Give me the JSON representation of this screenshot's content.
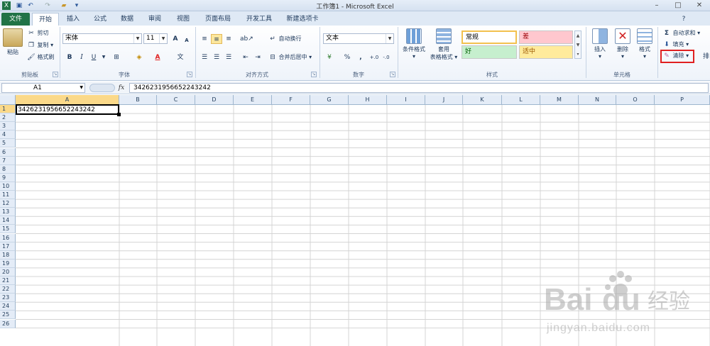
{
  "window": {
    "title": "工作簿1 - Microsoft Excel"
  },
  "tabs": [
    "文件",
    "开始",
    "插入",
    "公式",
    "数据",
    "审阅",
    "视图",
    "页面布局",
    "开发工具",
    "新建选项卡"
  ],
  "clipboard": {
    "paste": "粘贴",
    "cut": "剪切",
    "copy": "复制",
    "format_painter": "格式刷",
    "group": "剪贴板"
  },
  "font": {
    "name": "宋体",
    "size": "11",
    "bold": "B",
    "italic": "I",
    "underline": "U",
    "grow": "A",
    "shrink": "A",
    "group": "字体"
  },
  "alignment": {
    "wrap": "自动换行",
    "merge": "合并后居中",
    "group": "对齐方式"
  },
  "number": {
    "format": "文本",
    "percent": "%",
    "comma": ",",
    "inc_decimal": ".0→.00",
    "dec_decimal": ".00→.0",
    "group": "数字"
  },
  "styles": {
    "conditional": "条件格式",
    "table_line1": "套用",
    "table_line2": "表格格式",
    "normal": "常规",
    "bad": "差",
    "good": "好",
    "neutral": "适中",
    "group": "样式"
  },
  "cells": {
    "insert": "插入",
    "delete": "删除",
    "format": "格式",
    "group": "单元格"
  },
  "editing": {
    "autosum": "自动求和",
    "fill": "填充",
    "clear": "清除",
    "sigma": "Σ"
  },
  "formula_bar": {
    "name_box": "A1",
    "fx": "fx",
    "value": "342623195665224324​2"
  },
  "columns": [
    "A",
    "B",
    "C",
    "D",
    "E",
    "F",
    "G",
    "H",
    "I",
    "J",
    "K",
    "L",
    "M",
    "N",
    "O",
    "P"
  ],
  "rows": [
    "1",
    "2",
    "3",
    "4",
    "5",
    "6",
    "7",
    "8",
    "9",
    "10",
    "11",
    "12",
    "13",
    "14",
    "15",
    "16",
    "17",
    "18",
    "19",
    "20",
    "21",
    "22",
    "23",
    "24",
    "25",
    "26"
  ],
  "sheet": {
    "A1": "342623195665224324​2"
  },
  "watermark": {
    "brand": "Bai",
    "brand2": "du",
    "cn": "经验",
    "url": "jingyan.baidu.com"
  },
  "colors": {
    "accent": "#217346",
    "highlight": "#e02020",
    "selected_header": "#fbd989"
  }
}
